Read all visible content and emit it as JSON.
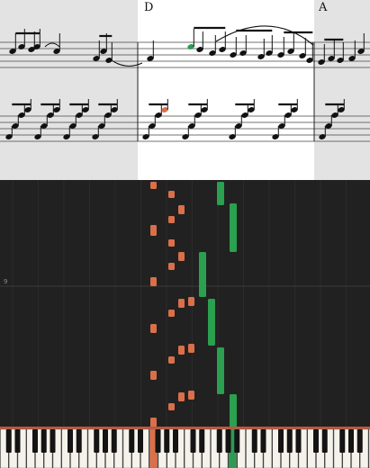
{
  "score": {
    "section_labels": [
      "D",
      "A"
    ],
    "highlight_color": "#ffffff",
    "background_color": "#e3e3e3",
    "active_note_colors": {
      "right_hand": "#2e9a53",
      "left_hand": "#d9704a"
    }
  },
  "piano_roll": {
    "measure_label": "9",
    "background_color": "#212121",
    "right_hand_color": "#2aa050",
    "left_hand_color": "#d9704a"
  },
  "keyboard": {
    "pressed_keys": [
      "left-hand-key",
      "right-hand-key"
    ]
  }
}
